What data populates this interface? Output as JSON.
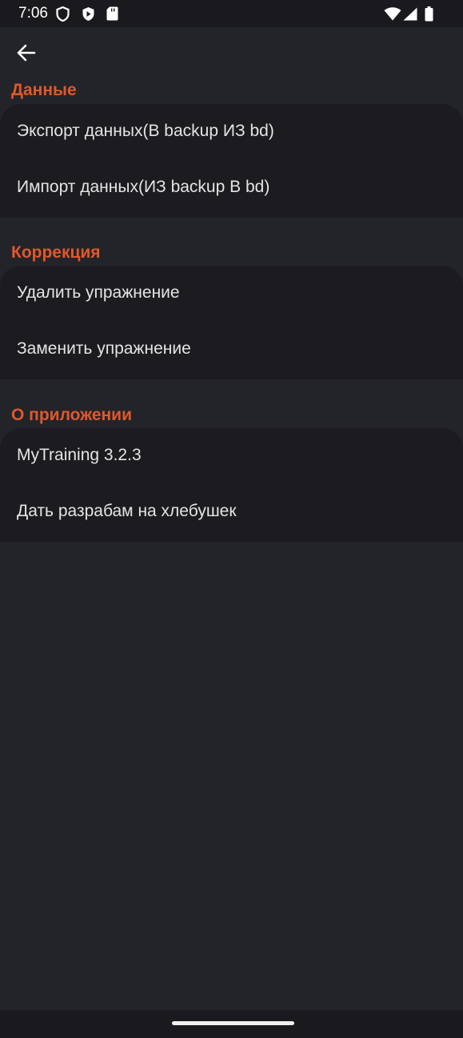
{
  "status_bar": {
    "time": "7:06"
  },
  "sections": [
    {
      "title": "Данные",
      "items": [
        {
          "label": "Экспорт данных(В backup ИЗ bd)"
        },
        {
          "label": "Импорт данных(ИЗ backup В bd)"
        }
      ]
    },
    {
      "title": "Коррекция",
      "items": [
        {
          "label": "Удалить упражнение"
        },
        {
          "label": "Заменить упражнение"
        }
      ]
    },
    {
      "title": "О приложении",
      "items": [
        {
          "label": "MyTraining 3.2.3"
        },
        {
          "label": "Дать разрабам на хлебушек"
        }
      ]
    }
  ],
  "colors": {
    "accent": "#e0582a",
    "background": "#232429",
    "card": "#1c1c20"
  }
}
